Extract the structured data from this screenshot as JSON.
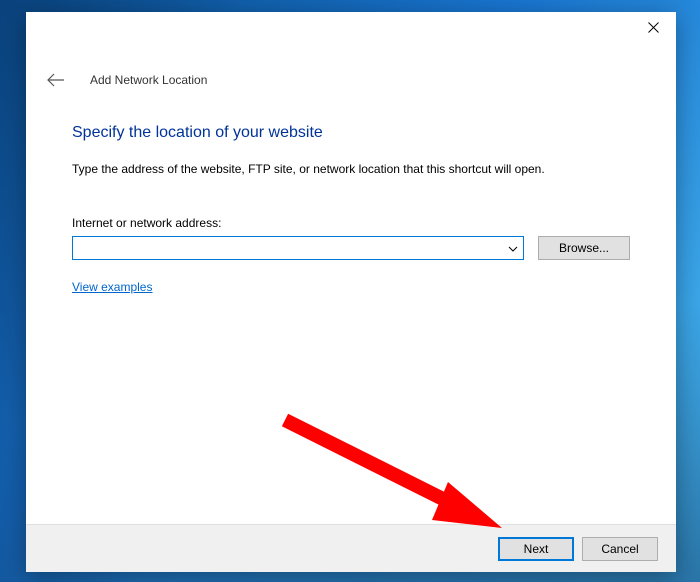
{
  "wizard": {
    "title": "Add Network Location"
  },
  "content": {
    "heading": "Specify the location of your website",
    "description": "Type the address of the website, FTP site, or network location that this shortcut will open.",
    "address_label": "Internet or network address:",
    "address_value": "",
    "browse_label": "Browse...",
    "examples_link": "View examples"
  },
  "footer": {
    "next_label": "Next",
    "cancel_label": "Cancel"
  }
}
